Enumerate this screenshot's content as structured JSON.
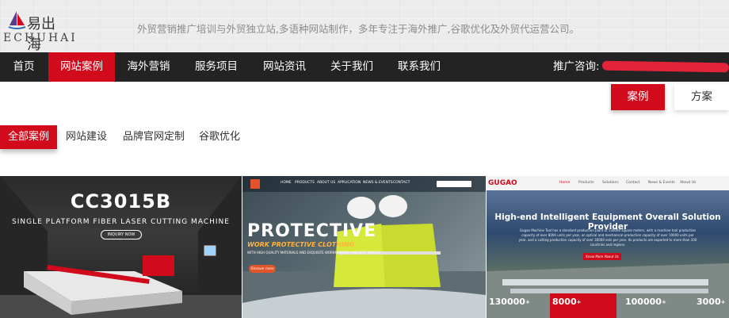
{
  "header": {
    "logo_cn": "易出海",
    "logo_en": "ECHUHAI",
    "tagline": "外贸营销推广培训与外贸独立站,多语种网站制作，多年专注于海外推广,谷歌优化及外贸代运营公司。"
  },
  "nav": {
    "items": [
      "首页",
      "网站案例",
      "海外营销",
      "服务项目",
      "网站资讯",
      "关于我们",
      "联系我们"
    ],
    "active_index": 1,
    "promo_label": "推广咨询:"
  },
  "view_tabs": {
    "case": "案例",
    "plan": "方案",
    "active": "case"
  },
  "filters": {
    "items": [
      "全部案例",
      "网站建设",
      "品牌官网定制",
      "谷歌优化"
    ],
    "active_index": 0
  },
  "cards": [
    {
      "title": "CC3015B",
      "subtitle": "SINGLE PLATFORM FIBER LASER CUTTING MACHINE",
      "button": "INQUIRY NOW"
    },
    {
      "nav": [
        "HOME",
        "PRODUCTS",
        "ABOUT US",
        "APPLICATION",
        "NEWS & EVENTS",
        "CONTACT"
      ],
      "title": "PROTECTIVE",
      "subtitle": "WORK PROTECTIVE CLOTHING",
      "desc": "WITH HIGH QUALITY MATERIALS AND EXQUISITE WORKMANSHIP AND BEST SERVICE",
      "button": "Discover more"
    },
    {
      "brand": "GUGAO",
      "nav": [
        "Home",
        "Products",
        "Solutions",
        "Contact",
        "News & Events",
        "About Us"
      ],
      "title": "High-end Intelligent Equipment Overall Solution Provider",
      "desc": "Gugao Machine Tool has a standard production plant of 130000 square meters, with a machine tool production capacity of over 8000 units per year, an optical and mechanical production capacity of over 10000 units per year, and a cutting production capacity of over 30000 sets per year. Its products are exported to more than 100 countries and regions.",
      "button": "Know More About Us",
      "stats": [
        "130000",
        "8000",
        "100000",
        "3000"
      ],
      "stat_plus": "+"
    }
  ],
  "colors": {
    "brand_red": "#d10b1c",
    "nav_bg": "#232323"
  }
}
